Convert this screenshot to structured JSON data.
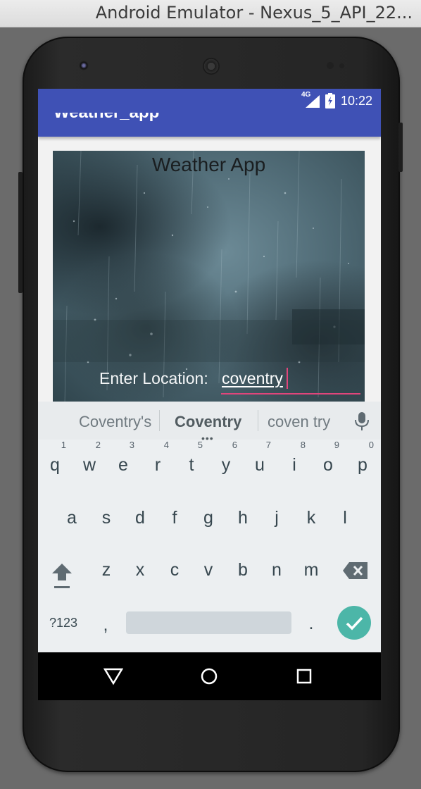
{
  "window": {
    "title": "Android Emulator - Nexus_5_API_22..."
  },
  "status_bar": {
    "network": "4G",
    "time": "10:22"
  },
  "app_bar": {
    "title": "Weather_app"
  },
  "content": {
    "image_title": "Weather App",
    "location_label": "Enter Location:",
    "location_value": "coventry"
  },
  "keyboard": {
    "suggestions": [
      "Coventry's",
      "Coventry",
      "coven try"
    ],
    "rows": [
      [
        {
          "key": "q",
          "hint": "1"
        },
        {
          "key": "w",
          "hint": "2"
        },
        {
          "key": "e",
          "hint": "3"
        },
        {
          "key": "r",
          "hint": "4"
        },
        {
          "key": "t",
          "hint": "5"
        },
        {
          "key": "y",
          "hint": "6"
        },
        {
          "key": "u",
          "hint": "7"
        },
        {
          "key": "i",
          "hint": "8"
        },
        {
          "key": "o",
          "hint": "9"
        },
        {
          "key": "p",
          "hint": "0"
        }
      ],
      [
        {
          "key": "a"
        },
        {
          "key": "s"
        },
        {
          "key": "d"
        },
        {
          "key": "f"
        },
        {
          "key": "g"
        },
        {
          "key": "h"
        },
        {
          "key": "j"
        },
        {
          "key": "k"
        },
        {
          "key": "l"
        }
      ],
      [
        {
          "key": "z"
        },
        {
          "key": "x"
        },
        {
          "key": "c"
        },
        {
          "key": "v"
        },
        {
          "key": "b"
        },
        {
          "key": "n"
        },
        {
          "key": "m"
        }
      ]
    ],
    "symbols_label": "?123",
    "comma_label": ",",
    "period_label": ".",
    "accent_color": "#4cb6a8"
  },
  "navigation": {
    "icons": [
      "back-triangle-icon",
      "home-circle-icon",
      "recents-square-icon"
    ]
  },
  "colors": {
    "primary": "#3f51b5",
    "input_accent": "#e0457b"
  }
}
